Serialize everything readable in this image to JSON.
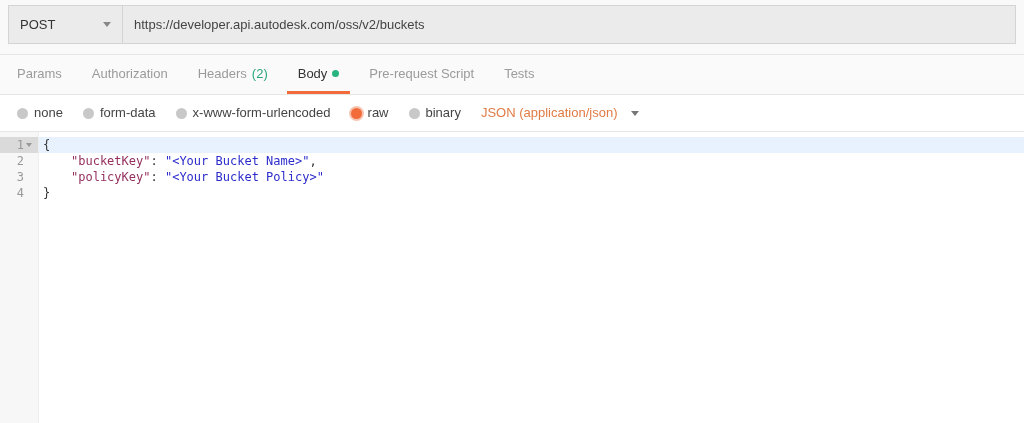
{
  "request": {
    "method": "POST",
    "url": "https://developer.api.autodesk.com/oss/v2/buckets"
  },
  "tabs": [
    {
      "label": "Params",
      "selected": false
    },
    {
      "label": "Authorization",
      "selected": false
    },
    {
      "label": "Headers",
      "count": "(2)",
      "selected": false
    },
    {
      "label": "Body",
      "indicator": true,
      "selected": true
    },
    {
      "label": "Pre-request Script",
      "selected": false
    },
    {
      "label": "Tests",
      "selected": false
    }
  ],
  "body_types": [
    {
      "label": "none",
      "selected": false
    },
    {
      "label": "form-data",
      "selected": false
    },
    {
      "label": "x-www-form-urlencoded",
      "selected": false
    },
    {
      "label": "raw",
      "selected": true
    },
    {
      "label": "binary",
      "selected": false
    }
  ],
  "content_type": "JSON (application/json)",
  "editor": {
    "lines": [
      {
        "number": "1",
        "active": true,
        "foldable": true,
        "tokens": [
          {
            "kind": "punct",
            "text": "{"
          }
        ]
      },
      {
        "number": "2",
        "active": false,
        "foldable": false,
        "tokens": [
          {
            "kind": "indent"
          },
          {
            "kind": "key",
            "text": "\"bucketKey\""
          },
          {
            "kind": "punct",
            "text": ": "
          },
          {
            "kind": "string",
            "text": "\"<Your Bucket Name>\""
          },
          {
            "kind": "punct",
            "text": ","
          }
        ]
      },
      {
        "number": "3",
        "active": false,
        "foldable": false,
        "tokens": [
          {
            "kind": "indent"
          },
          {
            "kind": "key",
            "text": "\"policyKey\""
          },
          {
            "kind": "punct",
            "text": ": "
          },
          {
            "kind": "string",
            "text": "\"<Your Bucket Policy>\""
          }
        ]
      },
      {
        "number": "4",
        "active": false,
        "foldable": false,
        "tokens": [
          {
            "kind": "punct",
            "text": "}"
          }
        ]
      }
    ]
  }
}
